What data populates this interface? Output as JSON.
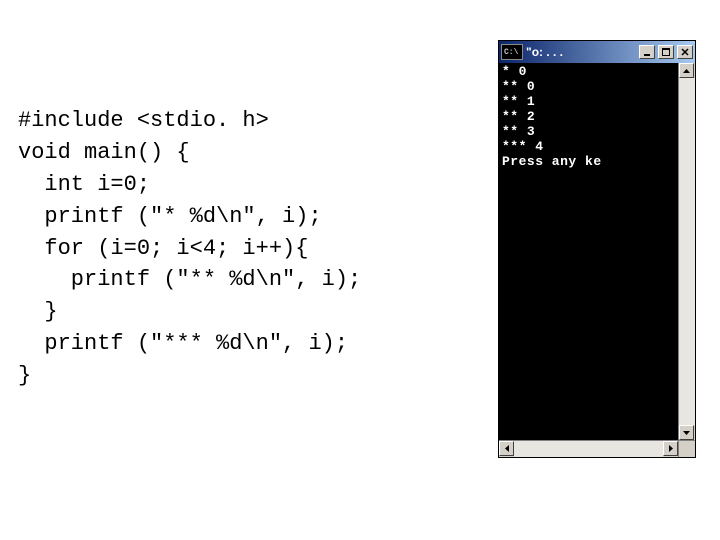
{
  "code": {
    "lines": [
      "#include <stdio. h>",
      "void main() {",
      "  int i=0;",
      "  printf (\"* %d\\n\", i);",
      "  for (i=0; i<4; i++){",
      "    printf (\"** %d\\n\", i);",
      "  }",
      "  printf (\"*** %d\\n\", i);",
      "}"
    ]
  },
  "console": {
    "icon_text": "C:\\",
    "title": "\"o: . . .",
    "output_lines": [
      "* 0",
      "** 0",
      "** 1",
      "** 2",
      "** 3",
      "*** 4",
      "Press any ke"
    ]
  }
}
